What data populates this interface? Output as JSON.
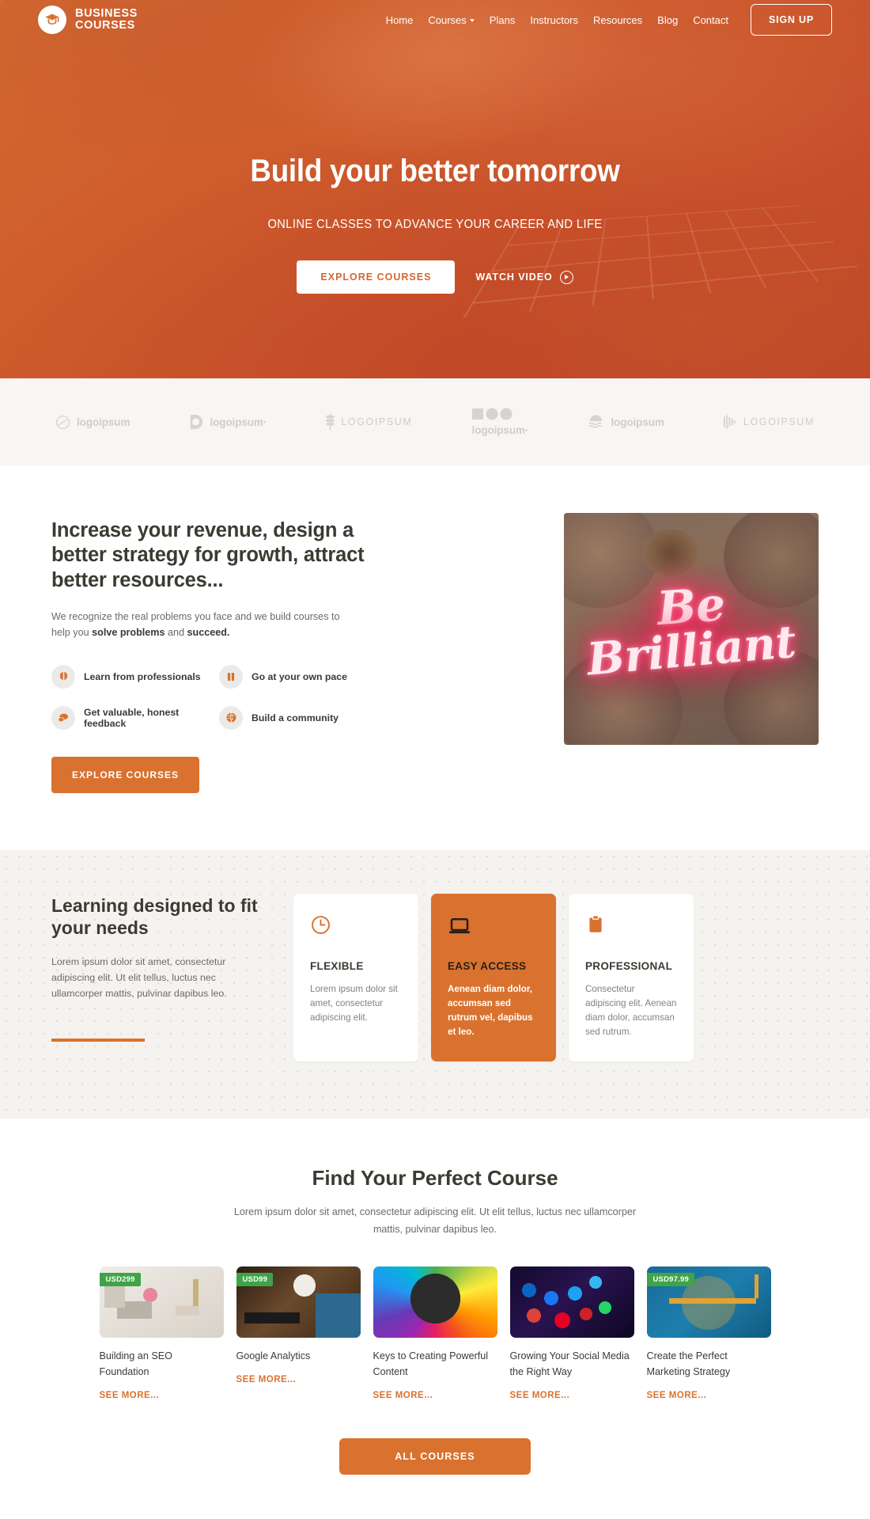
{
  "nav": {
    "logo": {
      "line1": "BUSINESS",
      "line2": "COURSES",
      "icon": "graduation-cap-icon"
    },
    "links": [
      {
        "label": "Home",
        "caret": false
      },
      {
        "label": "Courses",
        "caret": true
      },
      {
        "label": "Plans",
        "caret": false
      },
      {
        "label": "Instructors",
        "caret": false
      },
      {
        "label": "Resources",
        "caret": false
      },
      {
        "label": "Blog",
        "caret": false
      },
      {
        "label": "Contact",
        "caret": false
      }
    ],
    "signup_label": "SIGN UP"
  },
  "hero": {
    "title": "Build your better tomorrow",
    "subtitle": "ONLINE CLASSES TO ADVANCE YOUR CAREER AND LIFE",
    "primary_cta": "EXPLORE COURSES",
    "secondary_cta": "WATCH VIDEO"
  },
  "logostrip": [
    {
      "name": "logoipsum",
      "style": "lower"
    },
    {
      "name": "logoipsum·",
      "style": "lower"
    },
    {
      "name": "LOGOIPSUM",
      "style": "wide"
    },
    {
      "name": "logoipsum·",
      "style": "stack"
    },
    {
      "name": "logoipsum",
      "style": "lower"
    },
    {
      "name": "LOGOIPSUM",
      "style": "wide"
    }
  ],
  "revenue": {
    "title": "Increase your revenue, design a better strategy for growth, attract better resources...",
    "paragraph_start": "We recognize the real problems you face and we build courses to help you ",
    "paragraph_bold1": "solve problems",
    "paragraph_mid": " and ",
    "paragraph_bold2": "succeed.",
    "features": [
      {
        "label": "Learn from professionals",
        "icon": "brain-icon"
      },
      {
        "label": "Go at your own pace",
        "icon": "pause-icon"
      },
      {
        "label": "Get valuable, honest feedback",
        "icon": "chat-bubbles-icon"
      },
      {
        "label": "Build a community",
        "icon": "globe-icon"
      }
    ],
    "cta": "EXPLORE COURSES",
    "image_text_line1": "Be",
    "image_text_line2": "Brilliant",
    "image_alt": "neon-sign-be-brilliant"
  },
  "learning": {
    "title": "Learning designed to fit your needs",
    "paragraph": "Lorem ipsum dolor sit amet, consectetur adipiscing elit. Ut elit tellus, luctus nec ullamcorper mattis, pulvinar dapibus leo.",
    "cards": [
      {
        "title": "FLEXIBLE",
        "text": "Lorem ipsum dolor sit amet, consectetur adipiscing elit.",
        "icon": "clock-icon",
        "accent": false
      },
      {
        "title": "EASY ACCESS",
        "text": "Aenean diam dolor, accumsan sed rutrum vel, dapibus et leo.",
        "icon": "laptop-icon",
        "accent": true
      },
      {
        "title": "PROFESSIONAL",
        "text": "Consectetur adipiscing elit. Aenean diam dolor, accumsan sed rutrum.",
        "icon": "clipboard-icon",
        "accent": false
      }
    ]
  },
  "courses": {
    "title": "Find Your Perfect Course",
    "subtitle": "Lorem ipsum dolor sit amet, consectetur adipiscing elit. Ut elit tellus, luctus nec ullamcorper mattis, pulvinar dapibus leo.",
    "see_more_label": "SEE MORE...",
    "items": [
      {
        "name": "Building an SEO Foundation",
        "price": "USD299",
        "has_price": true,
        "thumb": "desk-laptop-flowers"
      },
      {
        "name": "Google Analytics",
        "price": "USD99",
        "has_price": true,
        "thumb": "tablet-coffee-charts"
      },
      {
        "name": "Keys to Creating Powerful Content",
        "price": "",
        "has_price": false,
        "thumb": "color-wheel-diagram"
      },
      {
        "name": "Growing Your Social Media the Right Way",
        "price": "",
        "has_price": false,
        "thumb": "social-app-icons"
      },
      {
        "name": "Create the Perfect Marketing Strategy",
        "price": "USD97.99",
        "has_price": true,
        "thumb": "strategy-infographic"
      }
    ],
    "all_courses_label": "ALL COURSES"
  },
  "colors": {
    "brand_orange": "#d9722f",
    "hero_orange": "#cf5c2c",
    "badge_green": "#3fa447",
    "text_dark": "#3d3a33",
    "text_muted": "#6d6a64"
  }
}
